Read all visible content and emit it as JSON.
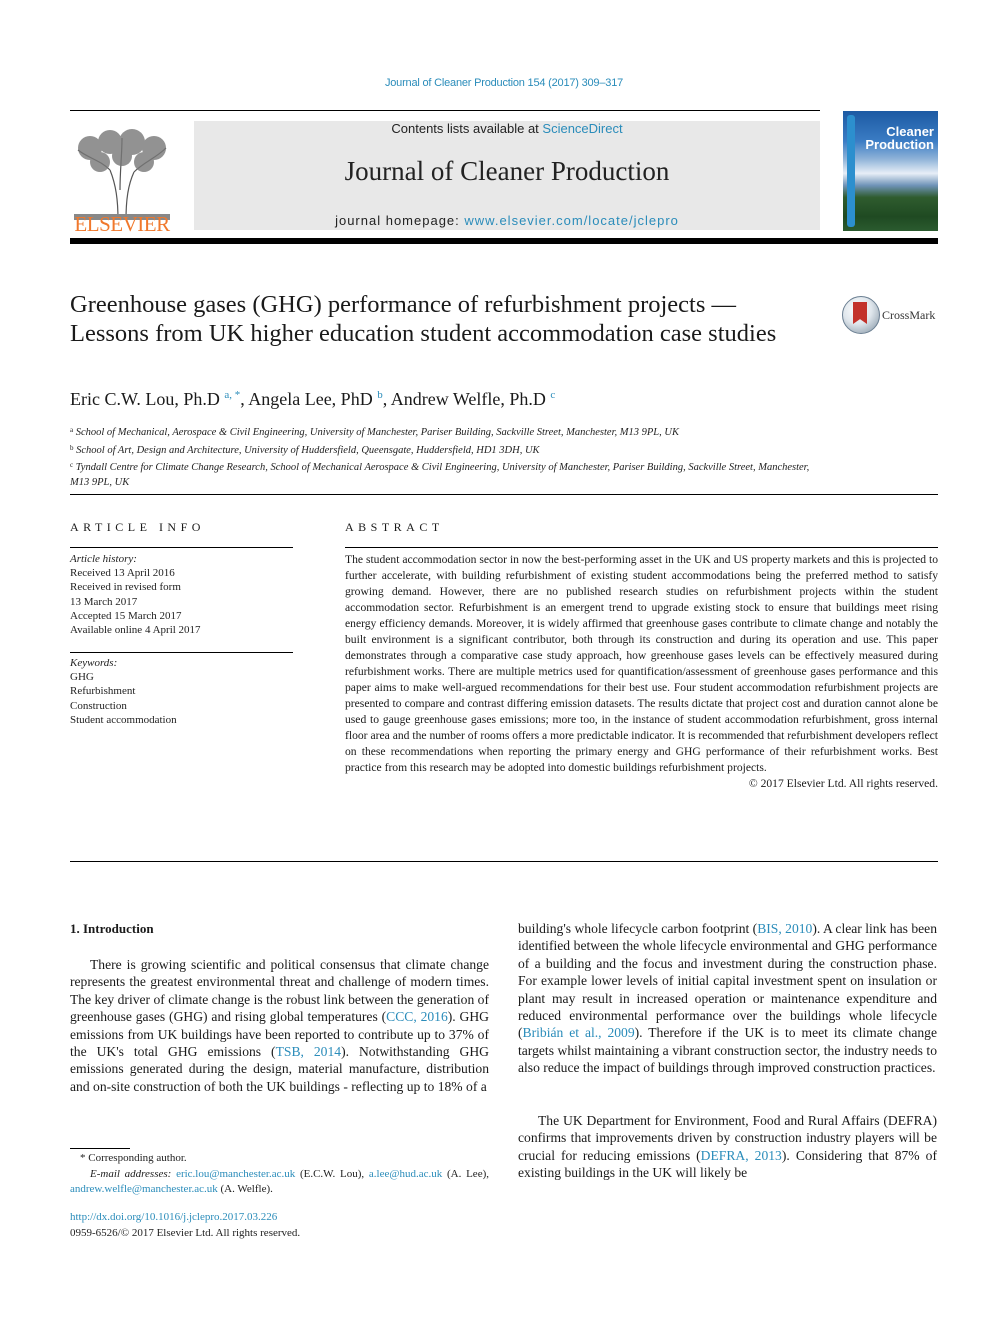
{
  "running_head": "Journal of Cleaner Production 154 (2017) 309–317",
  "publisher": {
    "logo_icon": "elsevier-tree-icon",
    "wordmark": "ELSEVIER"
  },
  "banner": {
    "contents_prefix": "Contents lists available at ",
    "contents_link": "ScienceDirect",
    "journal_title": "Journal of Cleaner Production",
    "homepage_prefix": "journal homepage: ",
    "homepage_link": "www.elsevier.com/locate/jclepro"
  },
  "cover": {
    "title_line1": "Cleaner",
    "title_line2": "Production",
    "image_icon": "journal-cover-mountain-image"
  },
  "article": {
    "title": "Greenhouse gases (GHG) performance of refurbishment projects — Lessons from UK higher education student accommodation case studies",
    "crossmark_label": "CrossMark",
    "authors": [
      {
        "name": "Eric C.W. Lou, Ph.D",
        "sup": "a, *"
      },
      {
        "name": "Angela Lee, PhD",
        "sup": "b"
      },
      {
        "name": "Andrew Welfle, Ph.D",
        "sup": "c"
      }
    ],
    "affiliations": [
      {
        "sup": "a",
        "text": "School of Mechanical, Aerospace & Civil Engineering, University of Manchester, Pariser Building, Sackville Street, Manchester, M13 9PL, UK"
      },
      {
        "sup": "b",
        "text": "School of Art, Design and Architecture, University of Huddersfield, Queensgate, Huddersfield, HD1 3DH, UK"
      },
      {
        "sup": "c",
        "text": "Tyndall Centre for Climate Change Research, School of Mechanical Aerospace & Civil Engineering, University of Manchester, Pariser Building, Sackville Street, Manchester, M13 9PL, UK"
      }
    ]
  },
  "article_info": {
    "heading": "ARTICLE INFO",
    "history_label": "Article history:",
    "history": [
      "Received 13 April 2016",
      "Received in revised form",
      "13 March 2017",
      "Accepted 15 March 2017",
      "Available online 4 April 2017"
    ],
    "keywords_label": "Keywords:",
    "keywords": [
      "GHG",
      "Refurbishment",
      "Construction",
      "Student accommodation"
    ]
  },
  "abstract": {
    "heading": "ABSTRACT",
    "text": "The student accommodation sector in now the best-performing asset in the UK and US property markets and this is projected to further accelerate, with building refurbishment of existing student accommo­dations being the preferred method to satisfy growing demand. However, there are no published research studies on refurbishment projects within the student accommodation sector. Refurbishment is an emergent trend to upgrade existing stock to ensure that buildings meet rising energy efficiency de­mands. Moreover, it is widely affirmed that greenhouse gases contribute to climate change and notably the built environment is a significant contributor, both through its construction and during its operation and use. This paper demonstrates through a comparative case study approach, how greenhouse gases levels can be effectively measured during refurbishment works. There are multiple metrics used for quantification/assessment of greenhouse gases performance and this paper aims to make well-argued recommendations for their best use. Four student accommodation refurbishment projects are pre­sented to compare and contrast differing emission datasets. The results dictate that project cost and duration cannot alone be used to gauge greenhouse gases emissions; more too, in the instance of student accommodation refurbishment, gross internal floor area and the number of rooms offers a more pre­dictable indicator. It is recommended that refurbishment developers reflect on these recommendations when reporting the primary energy and GHG performance of their refurbishment works. Best practice from this research may be adopted into domestic buildings refurbishment projects.",
    "copyright": "© 2017 Elsevier Ltd. All rights reserved."
  },
  "introduction": {
    "heading": "1.  Introduction",
    "left_p1": [
      {
        "t": "There is growing scientific and political consensus that climate change represents the greatest environmental threat and challenge of modern times. The key driver of climate change is the robust link between the generation of greenhouse gases (GHG) and rising global temperatures ("
      },
      {
        "link": "CCC, 2016"
      },
      {
        "t": "). GHG emissions from UK buildings have been reported to contribute up to 37% of the UK's total GHG emissions ("
      },
      {
        "link": "TSB, 2014"
      },
      {
        "t": "). Notwithstanding GHG emissions generated during the design, material manufacture, distribution and on-site construction of both the UK buildings - reflecting up to 18% of a"
      }
    ],
    "right_p1": [
      {
        "t": "building's whole lifecycle carbon footprint ("
      },
      {
        "link": "BIS, 2010"
      },
      {
        "t": "). A clear link has been identified between the whole lifecycle environmental and GHG performance of a building and the focus and investment during the construction phase. For example lower levels of initial capital investment spent on insulation or plant may result in increased operation or maintenance expenditure and reduced environmental performance over the buildings whole lifecycle ("
      },
      {
        "link": "Bribián et al., 2009"
      },
      {
        "t": "). Therefore if the UK is to meet its climate change targets whilst maintaining a vibrant construction sector, the industry needs to also reduce the impact of buildings through improved construction practices."
      }
    ],
    "right_p2": [
      {
        "t": "The UK Department for Environment, Food and Rural Affairs (DEFRA) confirms that improvements driven by construction in­dustry players will be crucial for reducing emissions ("
      },
      {
        "link": "DEFRA, 2013"
      },
      {
        "t": "). Considering that 87% of existing buildings in the UK will likely be"
      }
    ]
  },
  "footnotes": {
    "corresponding": "* Corresponding author.",
    "email_label": "E-mail addresses:",
    "emails": [
      {
        "addr": "eric.lou@manchester.ac.uk",
        "who": " (E.C.W. Lou), "
      },
      {
        "addr": "a.lee@hud.ac.uk",
        "who": " (A. Lee), "
      },
      {
        "addr": "andrew.welfle@manchester.ac.uk",
        "who": " (A. Welfle)."
      }
    ],
    "doi": "http://dx.doi.org/10.1016/j.jclepro.2017.03.226",
    "issn": "0959-6526/© 2017 Elsevier Ltd. All rights reserved."
  }
}
